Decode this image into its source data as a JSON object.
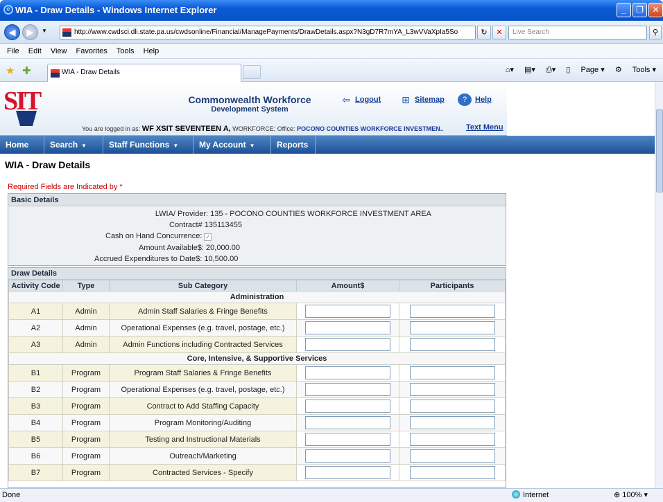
{
  "window": {
    "title": "WIA - Draw Details - Windows Internet Explorer",
    "url": "http://www.cwdsci.dli.state.pa.us/cwdsonline/Financial/ManagePayments/DrawDetails.aspx?N3gD7R7mYA_L3wVVaXpIa5So",
    "search_placeholder": "Live Search",
    "menu": [
      "File",
      "Edit",
      "View",
      "Favorites",
      "Tools",
      "Help"
    ],
    "tab_title": "WIA - Draw Details",
    "toolbar_page": "Page",
    "toolbar_tools": "Tools",
    "status_left": "Done",
    "status_zone": "Internet",
    "status_zoom": "100%"
  },
  "header": {
    "logo": "SIT",
    "system_line1": "Commonwealth Workforce",
    "system_line2": "Development System",
    "logout": "Logout",
    "sitemap": "Sitemap",
    "help": "Help",
    "logged_in_prefix": "You are logged in as:",
    "user": "WF XSIT SEVENTEEN A,",
    "org": "WORKFORCE; Office:",
    "office": "POCONO COUNTIES WORKFORCE INVESTMEN..",
    "text_menu": "Text Menu"
  },
  "nav": [
    "Home",
    "Search",
    "Staff Functions",
    "My Account",
    "Reports"
  ],
  "page": {
    "title": "WIA - Draw Details",
    "required_note": "Required Fields are Indicated by *"
  },
  "basic": {
    "heading": "Basic Details",
    "lwia_label": "LWIA/ Provider:",
    "lwia_value": "135 - POCONO COUNTIES WORKFORCE INVESTMENT AREA",
    "contract_label": "Contract#",
    "contract_value": "135113455",
    "cash_label": "Cash on Hand Concurrence:",
    "available_label": "Amount Available$:",
    "available_value": "20,000.00",
    "accrued_label": "Accrued Expenditures to Date$:",
    "accrued_value": "10,500.00"
  },
  "draw": {
    "heading": "Draw Details",
    "columns": [
      "Activity Code",
      "Type",
      "Sub Category",
      "Amount$",
      "Participants"
    ],
    "groups": [
      {
        "name": "Administration",
        "rows": [
          {
            "code": "A1",
            "type": "Admin",
            "sub": "Admin Staff Salaries & Fringe Benefits"
          },
          {
            "code": "A2",
            "type": "Admin",
            "sub": "Operational Expenses (e.g. travel, postage, etc.)"
          },
          {
            "code": "A3",
            "type": "Admin",
            "sub": "Admin Functions including Contracted Services"
          }
        ]
      },
      {
        "name": "Core, Intensive, & Supportive Services",
        "rows": [
          {
            "code": "B1",
            "type": "Program",
            "sub": "Program Staff Salaries & Fringe Benefits"
          },
          {
            "code": "B2",
            "type": "Program",
            "sub": "Operational Expenses (e.g. travel, postage, etc.)"
          },
          {
            "code": "B3",
            "type": "Program",
            "sub": "Contract to Add Staffing Capacity"
          },
          {
            "code": "B4",
            "type": "Program",
            "sub": "Program Monitoring/Auditing"
          },
          {
            "code": "B5",
            "type": "Program",
            "sub": "Testing and Instructional Materials"
          },
          {
            "code": "B6",
            "type": "Program",
            "sub": "Outreach/Marketing"
          },
          {
            "code": "B7",
            "type": "Program",
            "sub": "Contracted Services - Specify"
          }
        ]
      }
    ]
  }
}
